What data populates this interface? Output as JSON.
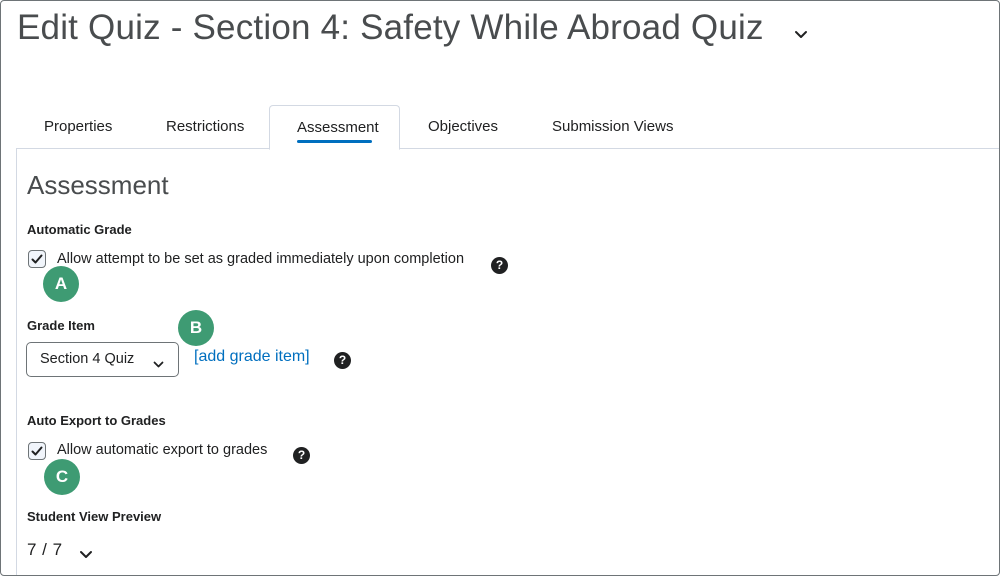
{
  "header": {
    "title": "Edit Quiz - Section 4: Safety While Abroad Quiz"
  },
  "tabs": [
    {
      "label": "Properties",
      "active": false
    },
    {
      "label": "Restrictions",
      "active": false
    },
    {
      "label": "Assessment",
      "active": true
    },
    {
      "label": "Objectives",
      "active": false
    },
    {
      "label": "Submission Views",
      "active": false
    }
  ],
  "assessment": {
    "heading": "Assessment",
    "automatic_grade": {
      "label": "Automatic Grade",
      "checkbox_label": "Allow attempt to be set as graded immediately upon completion",
      "checked": true
    },
    "grade_item": {
      "label": "Grade Item",
      "selected": "Section 4 Quiz",
      "add_link": "[add grade item]"
    },
    "auto_export": {
      "label": "Auto Export to Grades",
      "checkbox_label": "Allow automatic export to grades",
      "checked": true
    },
    "student_view_preview": {
      "label": "Student View Preview",
      "value": "7 / 7"
    }
  },
  "callouts": [
    "A",
    "B",
    "C"
  ],
  "help_glyph": "?",
  "colors": {
    "accent": "#006fbf",
    "callout": "#3e9b73",
    "title": "#494c4e"
  }
}
